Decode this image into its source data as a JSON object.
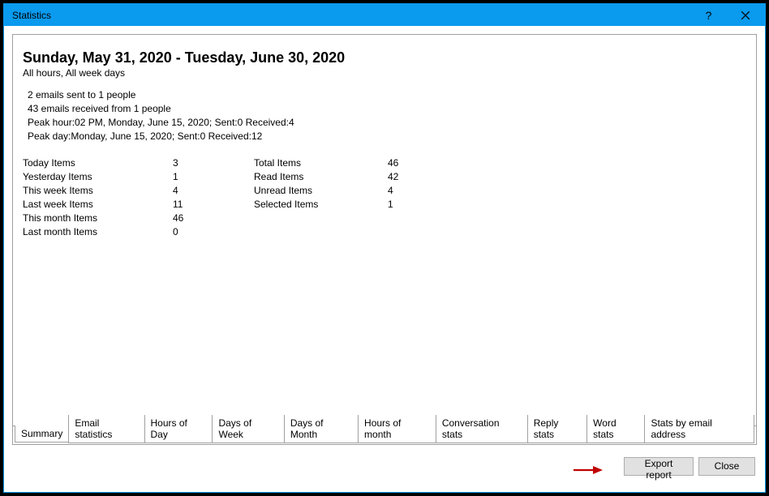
{
  "window": {
    "title": "Statistics"
  },
  "header": {
    "date_range": "Sunday, May 31, 2020 - Tuesday, June 30, 2020",
    "filter": "All hours, All week days"
  },
  "summary": {
    "line1": "2 emails sent to 1 people",
    "line2": "43 emails received from 1 people",
    "line3": "Peak hour:02 PM, Monday, June 15, 2020; Sent:0 Received:4",
    "line4": "Peak day:Monday, June 15, 2020; Sent:0 Received:12"
  },
  "metrics_left": [
    {
      "label": "Today Items",
      "value": "3"
    },
    {
      "label": "Yesterday Items",
      "value": "1"
    },
    {
      "label": "This week Items",
      "value": "4"
    },
    {
      "label": "Last week Items",
      "value": "11"
    },
    {
      "label": "This month Items",
      "value": "46"
    },
    {
      "label": "Last month Items",
      "value": "0"
    }
  ],
  "metrics_right": [
    {
      "label": "Total Items",
      "value": "46"
    },
    {
      "label": "Read Items",
      "value": "42"
    },
    {
      "label": "Unread Items",
      "value": "4"
    },
    {
      "label": "Selected Items",
      "value": "1"
    }
  ],
  "tabs": [
    {
      "label": "Summary",
      "active": true
    },
    {
      "label": "Email statistics"
    },
    {
      "label": "Hours of Day"
    },
    {
      "label": "Days of Week"
    },
    {
      "label": "Days of Month"
    },
    {
      "label": "Hours of month"
    },
    {
      "label": "Conversation stats"
    },
    {
      "label": "Reply stats"
    },
    {
      "label": "Word stats"
    },
    {
      "label": "Stats by email address"
    }
  ],
  "buttons": {
    "export": "Export report",
    "close": "Close"
  }
}
